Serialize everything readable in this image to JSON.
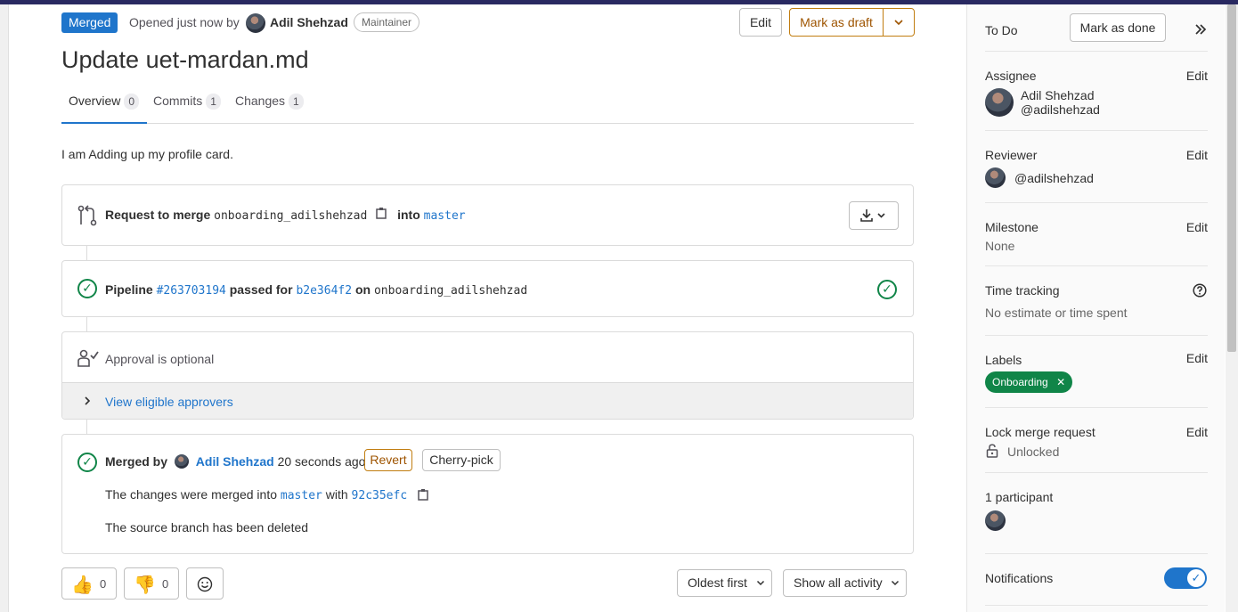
{
  "header": {
    "status_badge": "Merged",
    "opened_text": "Opened just now by",
    "author": "Adil Shehzad",
    "role": "Maintainer",
    "edit_label": "Edit",
    "draft_label": "Mark as draft",
    "title": "Update uet-mardan.md"
  },
  "tabs": [
    {
      "label": "Overview",
      "count": "0"
    },
    {
      "label": "Commits",
      "count": "1"
    },
    {
      "label": "Changes",
      "count": "1"
    }
  ],
  "description": "I am Adding up my profile card.",
  "merge_request": {
    "prefix": "Request to merge",
    "source_branch": "onboarding_adilshehzad",
    "into": "into",
    "target_branch": "master"
  },
  "pipeline": {
    "label": "Pipeline",
    "id": "#263703194",
    "passed_for": "passed for",
    "commit": "b2e364f2",
    "on": "on",
    "branch": "onboarding_adilshehzad"
  },
  "approval": {
    "text": "Approval is optional",
    "view_approvers": "View eligible approvers"
  },
  "merged": {
    "by_label": "Merged by",
    "user": "Adil Shehzad",
    "time": "20 seconds ago",
    "revert": "Revert",
    "cherry_pick": "Cherry-pick",
    "changes_text": "The changes were merged into",
    "target_branch": "master",
    "with": "with",
    "commit": "92c35efc",
    "deleted_text": "The source branch has been deleted"
  },
  "reactions": {
    "thumbs_up": "0",
    "thumbs_down": "0"
  },
  "activity": {
    "sort_label": "Oldest first",
    "filter_label": "Show all activity"
  },
  "sidebar": {
    "todo_label": "To Do",
    "mark_done": "Mark as done",
    "edit": "Edit",
    "assignee": {
      "title": "Assignee",
      "name": "Adil Shehzad",
      "username": "@adilshehzad"
    },
    "reviewer": {
      "title": "Reviewer",
      "username": "@adilshehzad"
    },
    "milestone": {
      "title": "Milestone",
      "value": "None"
    },
    "time_tracking": {
      "title": "Time tracking",
      "value": "No estimate or time spent"
    },
    "labels": {
      "title": "Labels",
      "label": "Onboarding",
      "color": "#108548"
    },
    "lock": {
      "title": "Lock merge request",
      "value": "Unlocked"
    },
    "participants": {
      "title": "1 participant"
    },
    "notifications": {
      "title": "Notifications",
      "enabled": true
    }
  },
  "colors": {
    "brand_blue": "#1f75cb",
    "success": "#108548",
    "warning": "#c17d10"
  }
}
